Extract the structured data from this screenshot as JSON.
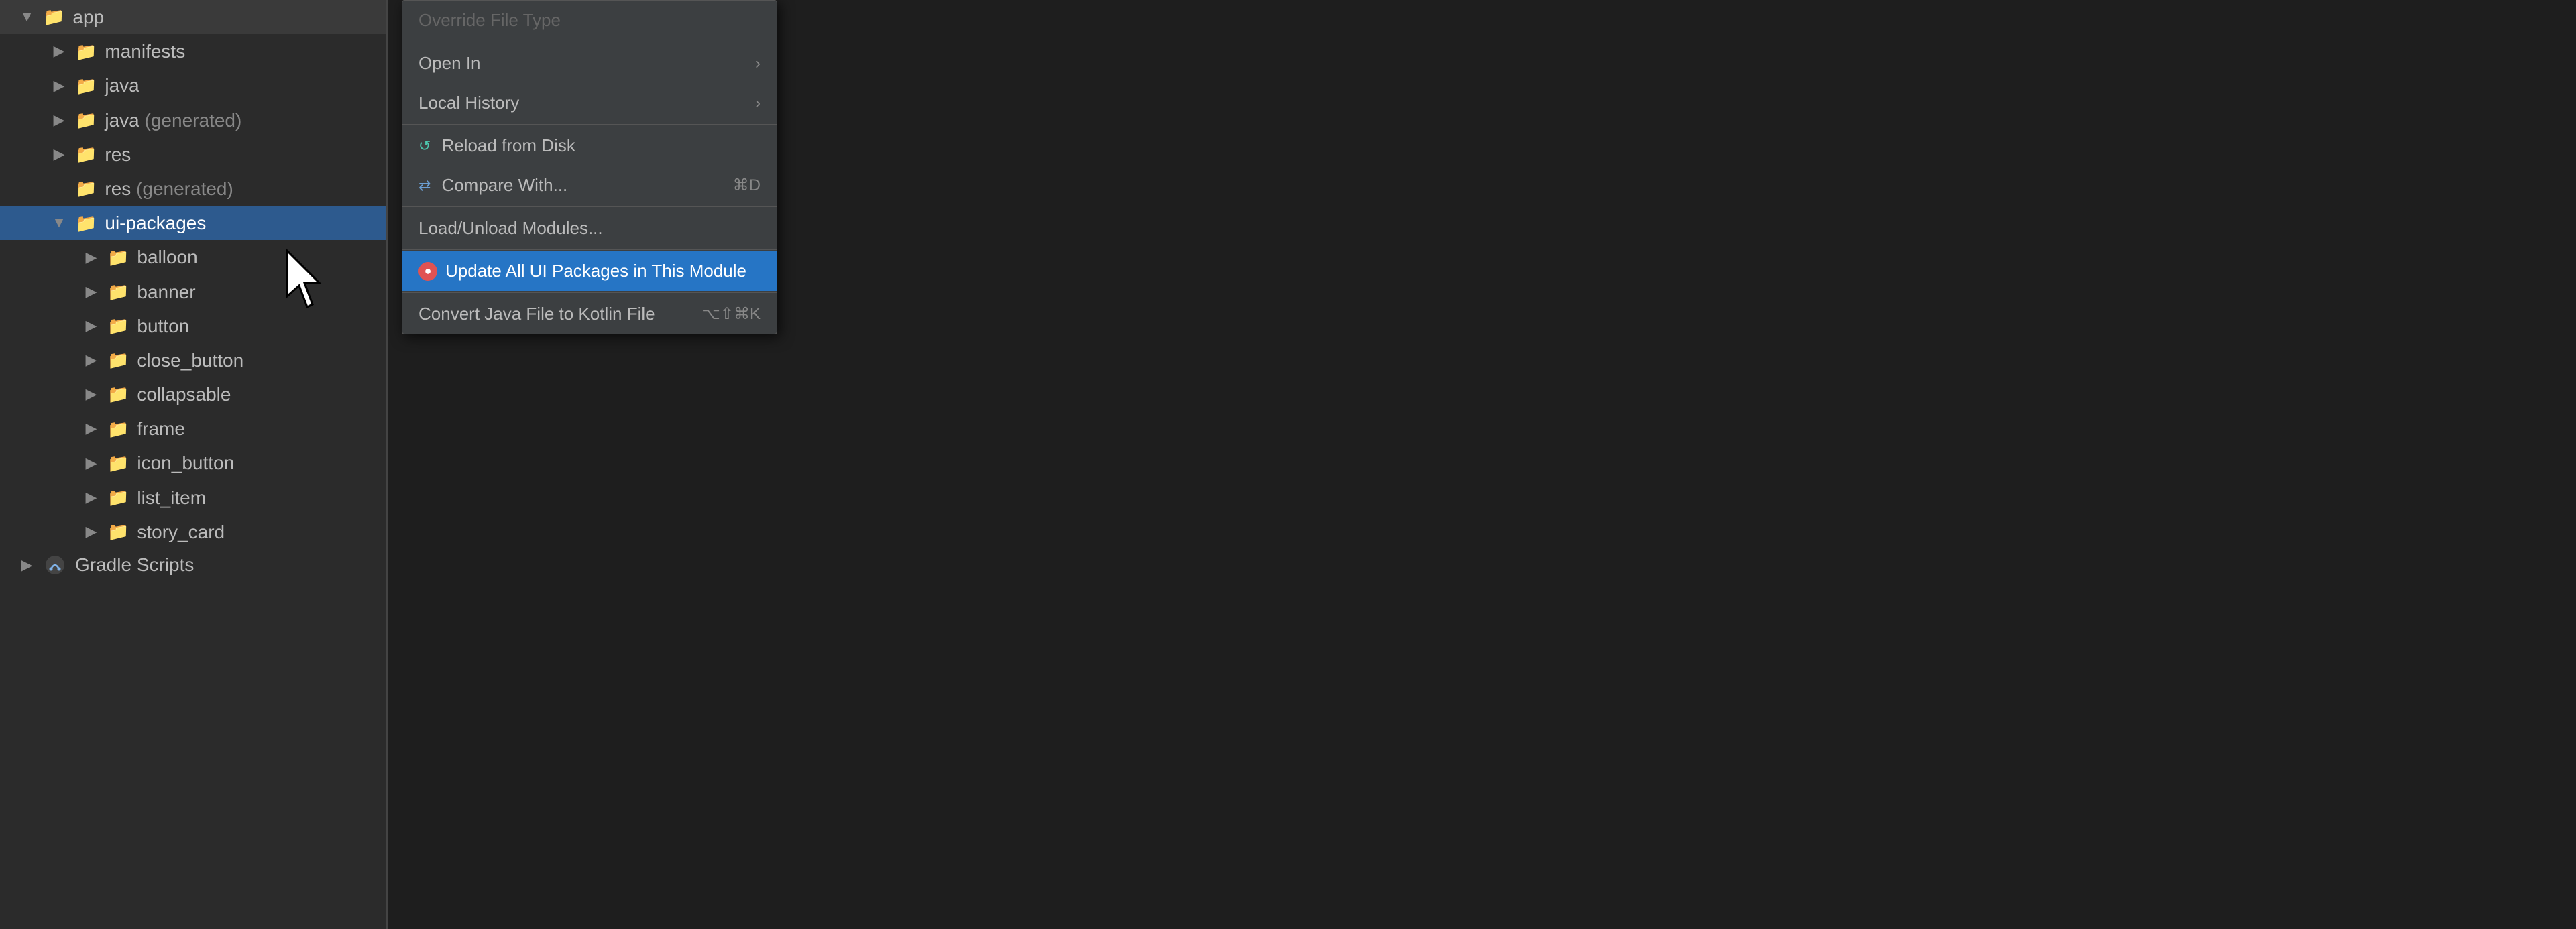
{
  "sidebar": {
    "items": [
      {
        "id": "app",
        "label": "app",
        "level": 0,
        "chevron": "▼",
        "type": "folder",
        "color": "blue",
        "expanded": true
      },
      {
        "id": "manifests",
        "label": "manifests",
        "level": 1,
        "chevron": "▶",
        "type": "folder",
        "color": "blue",
        "expanded": false
      },
      {
        "id": "java",
        "label": "java",
        "level": 1,
        "chevron": "▶",
        "type": "folder",
        "color": "blue",
        "expanded": false
      },
      {
        "id": "java-generated",
        "label": "java",
        "suffix": " (generated)",
        "level": 1,
        "chevron": "▶",
        "type": "folder",
        "color": "teal",
        "expanded": false
      },
      {
        "id": "res",
        "label": "res",
        "level": 1,
        "chevron": "▶",
        "type": "folder",
        "color": "blue",
        "expanded": false
      },
      {
        "id": "res-generated",
        "label": "res",
        "suffix": " (generated)",
        "level": 1,
        "chevron": "",
        "type": "folder",
        "color": "orange",
        "expanded": false,
        "noChevron": true
      },
      {
        "id": "ui-packages",
        "label": "ui-packages",
        "level": 1,
        "chevron": "▼",
        "type": "folder",
        "color": "blue",
        "expanded": true,
        "selected": true
      },
      {
        "id": "balloon",
        "label": "balloon",
        "level": 2,
        "chevron": "▶",
        "type": "folder",
        "color": "blue",
        "expanded": false
      },
      {
        "id": "banner",
        "label": "banner",
        "level": 2,
        "chevron": "▶",
        "type": "folder",
        "color": "blue",
        "expanded": false
      },
      {
        "id": "button",
        "label": "button",
        "level": 2,
        "chevron": "▶",
        "type": "folder",
        "color": "blue",
        "expanded": false
      },
      {
        "id": "close_button",
        "label": "close_button",
        "level": 2,
        "chevron": "▶",
        "type": "folder",
        "color": "blue",
        "expanded": false
      },
      {
        "id": "collapsable",
        "label": "collapsable",
        "level": 2,
        "chevron": "▶",
        "type": "folder",
        "color": "blue",
        "expanded": false
      },
      {
        "id": "frame",
        "label": "frame",
        "level": 2,
        "chevron": "▶",
        "type": "folder",
        "color": "blue",
        "expanded": false
      },
      {
        "id": "icon_button",
        "label": "icon_button",
        "level": 2,
        "chevron": "▶",
        "type": "folder",
        "color": "blue",
        "expanded": false
      },
      {
        "id": "list_item",
        "label": "list_item",
        "level": 2,
        "chevron": "▶",
        "type": "folder",
        "color": "blue",
        "expanded": false
      },
      {
        "id": "story_card",
        "label": "story_card",
        "level": 2,
        "chevron": "▶",
        "type": "folder",
        "color": "blue",
        "expanded": false
      }
    ],
    "gradle": {
      "label": "Gradle Scripts",
      "chevron": "▶"
    }
  },
  "context_menu": {
    "items": [
      {
        "id": "override-file-type",
        "label": "Override File Type",
        "disabled": true,
        "has_separator_below": true
      },
      {
        "id": "open-in",
        "label": "Open In",
        "has_arrow": true
      },
      {
        "id": "local-history",
        "label": "Local History",
        "has_arrow": true,
        "has_separator_below": true
      },
      {
        "id": "reload-from-disk",
        "label": "Reload from Disk",
        "has_reload_icon": true
      },
      {
        "id": "compare-with",
        "label": "Compare With...",
        "shortcut": "⌘D",
        "has_compare_icon": true,
        "has_separator_below": true
      },
      {
        "id": "load-unload-modules",
        "label": "Load/Unload Modules...",
        "has_separator_below": true
      },
      {
        "id": "update-all-ui",
        "label": "Update All UI Packages in This Module",
        "highlighted": true,
        "has_plugin_icon": true
      },
      {
        "id": "convert-java-kotlin",
        "label": "Convert Java File to Kotlin File",
        "shortcut": "⌥⇧⌘K"
      }
    ]
  }
}
